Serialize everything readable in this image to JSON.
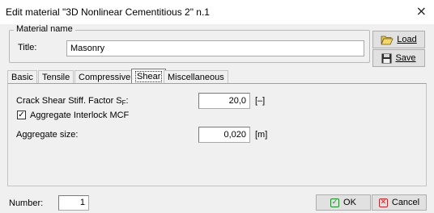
{
  "window": {
    "title": "Edit material  \"3D Nonlinear Cementitious 2\" n.1",
    "close_glyph": "×"
  },
  "material_name": {
    "legend": "Material name",
    "title_label": "Title:",
    "title_value": "Masonry"
  },
  "side_buttons": {
    "load_label": "Load",
    "save_label": "Save"
  },
  "tabs": [
    {
      "label": "Basic",
      "active": false
    },
    {
      "label": "Tensile",
      "active": false
    },
    {
      "label": "Compressive",
      "active": false
    },
    {
      "label": "Shear",
      "active": true
    },
    {
      "label": "Miscellaneous",
      "active": false
    }
  ],
  "shear": {
    "crack_shear_label": "Crack Shear Stiff. Factor S",
    "crack_shear_sub": "F",
    "crack_shear_colon": ":",
    "crack_shear_value": "20,0",
    "crack_shear_unit": "[–]",
    "aggregate_interlock_label": "Aggregate Interlock MCF",
    "aggregate_interlock_checked": true,
    "aggregate_size_label": "Aggregate size:",
    "aggregate_size_value": "0,020",
    "aggregate_size_unit": "[m]"
  },
  "footer": {
    "number_label": "Number:",
    "number_value": "1",
    "ok_label": "OK",
    "cancel_label": "Cancel"
  },
  "icons": {
    "load": "folder-open-icon",
    "save": "floppy-disk-icon",
    "ok": "checkmark-icon",
    "cancel": "x-icon"
  },
  "colors": {
    "ok_green": "#1f8a2a",
    "cancel_red": "#c6252b"
  }
}
